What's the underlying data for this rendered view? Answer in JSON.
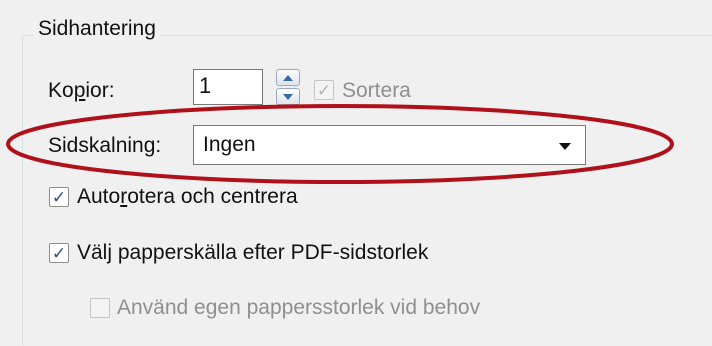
{
  "page_handling": {
    "legend": "Sidhantering",
    "copies": {
      "label_pre": "Ko",
      "label_underline": "p",
      "label_post": "ior:",
      "value": "1"
    },
    "collate": {
      "label": "Sortera",
      "checked": true,
      "enabled": false
    },
    "page_scaling": {
      "label": "Sidskalning:",
      "selected": "Ingen"
    },
    "auto_rotate": {
      "label_pre": "Auto",
      "label_underline": "r",
      "label_post": "otera och centrera",
      "checked": true
    },
    "paper_source": {
      "label_pre": "Väl",
      "label_underline": "j",
      "label_post": " papperskälla efter PDF-sidstorlek",
      "checked": true
    },
    "custom_paper_size": {
      "label": "Använd egen pappersstorlek vid behov",
      "checked": false,
      "enabled": false
    }
  },
  "annotation": {
    "ellipse_color": "#b0101a"
  },
  "icons": {
    "check": "✓",
    "spin_up": "triangle-up",
    "spin_down": "triangle-down",
    "dropdown": "triangle-down"
  }
}
